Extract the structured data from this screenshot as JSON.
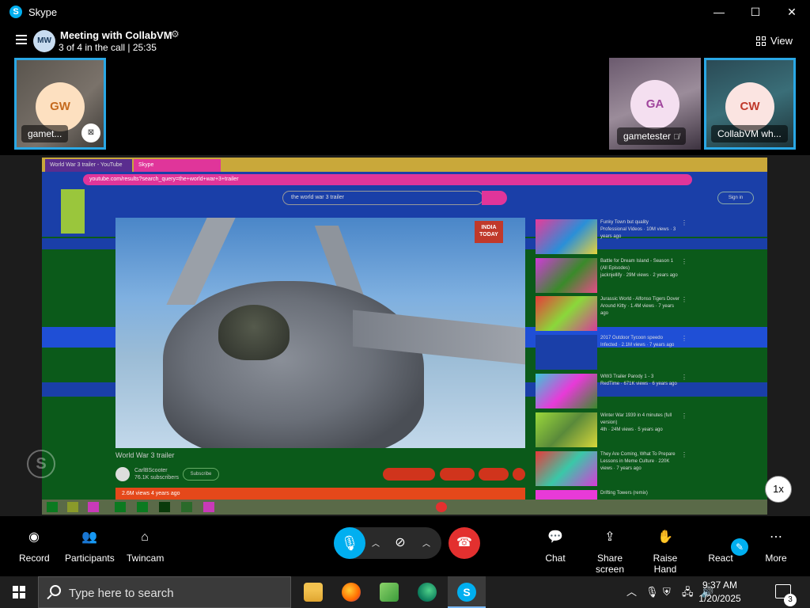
{
  "window": {
    "app_title": "Skype",
    "minimize": "—",
    "maximize": "☐",
    "close": "✕"
  },
  "header": {
    "avatar_initials": "MW",
    "meeting_title": "Meeting with CollabVM",
    "meeting_status": "3 of 4 in the call | 25:35",
    "view_label": "View"
  },
  "participants": [
    {
      "initials": "GW",
      "name": "gamet..."
    },
    {
      "initials": "GA",
      "name": "gametester"
    },
    {
      "initials": "CW",
      "name": "CollabVM wh..."
    }
  ],
  "shared_screen": {
    "tab1": "World War 3 trailer - YouTube",
    "tab2": "Skype",
    "address": "youtube.com/results?search_query=the+world+war+3+trailer",
    "search_value": "the world war 3 trailer",
    "sign_in": "Sign in",
    "news_badge": "INDIA TODAY",
    "video_title": "World War 3 trailer",
    "channel_name": "CarlBScooter",
    "channel_subs": "76.1K subscribers",
    "subscribe": "Subscribe",
    "description": "2.6M views  4 years ago",
    "sidebar": [
      {
        "title": "Funky Town but quality",
        "meta": "Professional Videos · 10M views · 3 years ago"
      },
      {
        "title": "Battle for Dream Island - Season 1 (All Episodes)",
        "meta": "jacknjellify · 29M views · 2 years ago"
      },
      {
        "title": "Jurassic World - Alfonso Tigers Dover",
        "meta": "Around Kitty · 1.4M views · 7 years ago"
      },
      {
        "title": "2017 Outdoor Tycoon speedo",
        "meta": "Infected · 2.1M views · 7 years ago"
      },
      {
        "title": "WW3 Trailer Parody 1 - 3",
        "meta": "RedTime · 671K views · 6 years ago"
      },
      {
        "title": "Winter War 1939 in 4 minutes (full version)",
        "meta": "4th · 24M views · 5 years ago"
      },
      {
        "title": "They Are Coming, What To Prepare",
        "meta": "Lessons in Meme Culture · 220K views · 7 years ago"
      },
      {
        "title": "Drifting Towers (remix)",
        "meta": ""
      }
    ],
    "playback_speed": "1x"
  },
  "controls": {
    "record": "Record",
    "participants": "Participants",
    "twincam": "Twincam",
    "chat": "Chat",
    "share_screen": "Share screen",
    "raise_hand": "Raise Hand",
    "react": "React",
    "more": "More"
  },
  "taskbar": {
    "search_placeholder": "Type here to search",
    "time": "9:37 AM",
    "date": "1/20/2025",
    "notification_count": "3"
  }
}
